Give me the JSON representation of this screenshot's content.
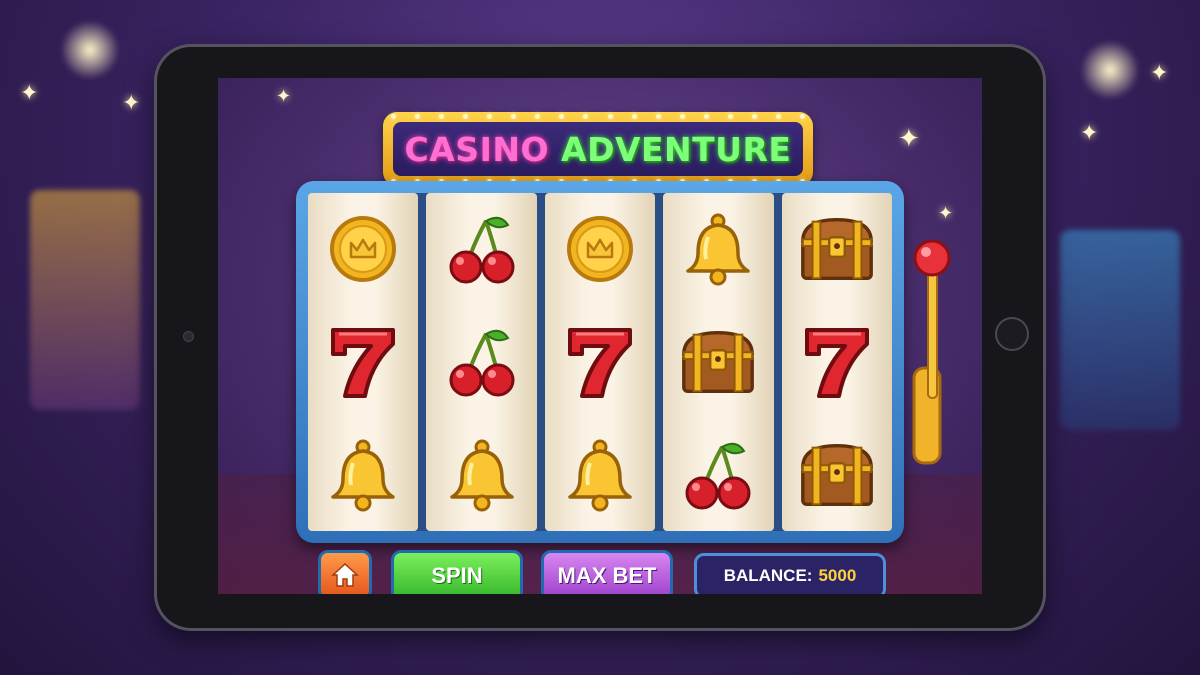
{
  "game": {
    "title_word_1": "CASINO",
    "title_word_2": "ADVENTURE"
  },
  "reels": [
    [
      "coin-crown-icon",
      "seven-icon",
      "bell-icon"
    ],
    [
      "cherry-icon",
      "cherry-icon",
      "bell-icon"
    ],
    [
      "coin-crown-icon",
      "seven-icon",
      "bell-icon"
    ],
    [
      "bell-icon",
      "treasure-chest-icon",
      "cherry-icon"
    ],
    [
      "treasure-chest-icon",
      "seven-icon",
      "treasure-chest-icon"
    ]
  ],
  "controls": {
    "home_icon": "home-icon",
    "spin_label": "SPIN",
    "max_bet_label": "MAX BET",
    "balance_label": "BALANCE:",
    "balance_value": "5000"
  },
  "colors": {
    "accent_gold": "#ffd23a",
    "spin_green": "#35b52a",
    "max_bet_purple": "#9b3fcb",
    "home_orange": "#e4561c",
    "frame_blue": "#2f6fb8"
  }
}
